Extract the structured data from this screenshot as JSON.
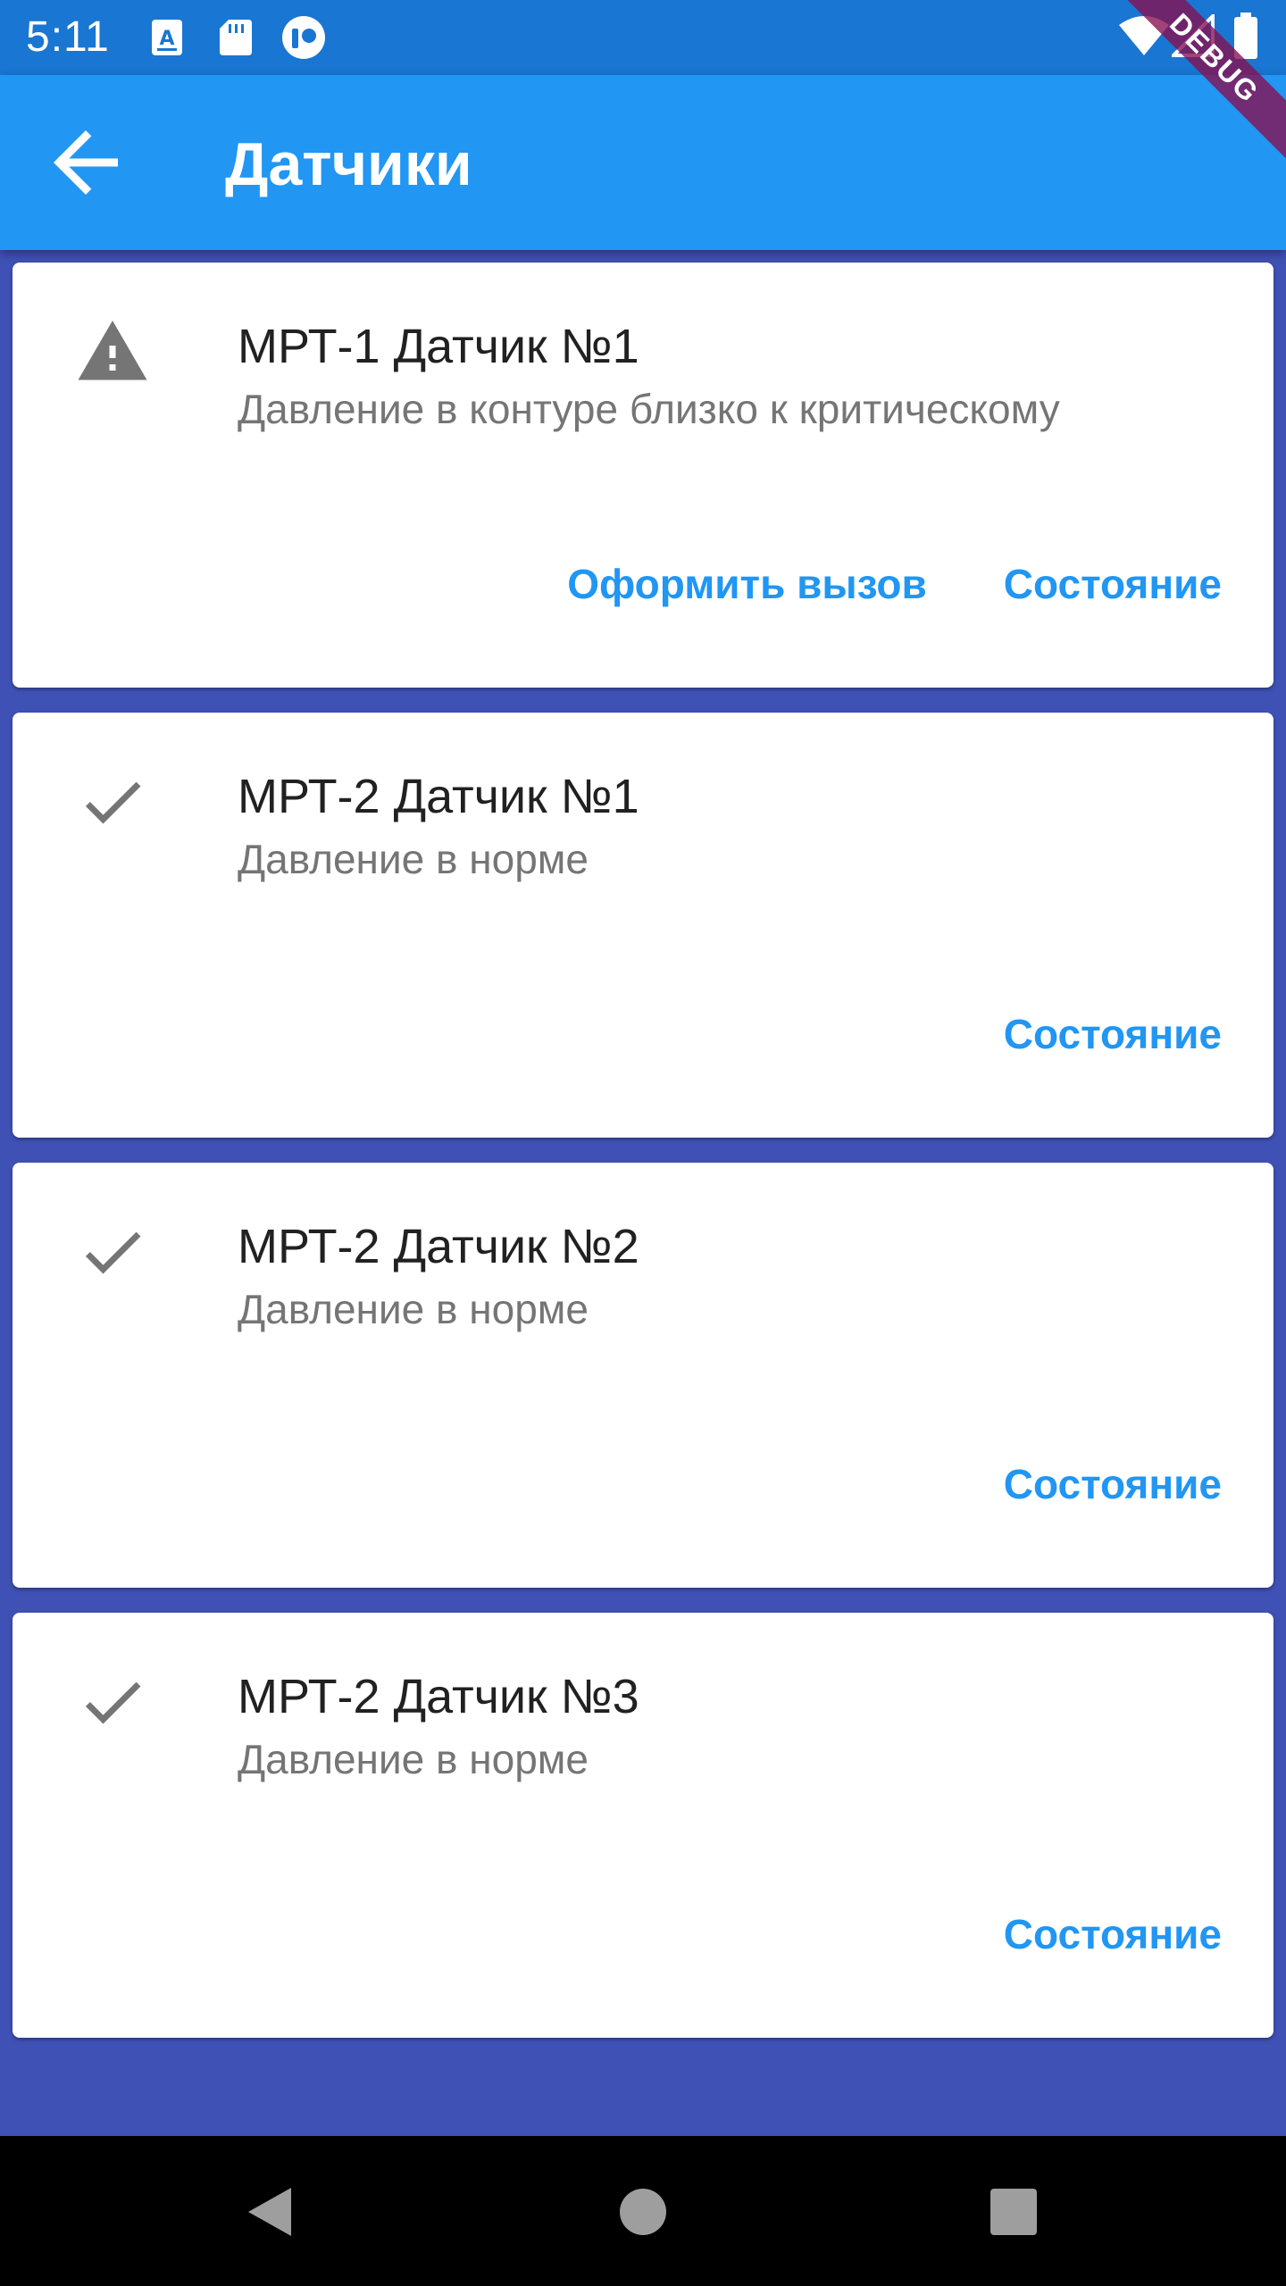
{
  "status_bar": {
    "time": "5:11",
    "icons": [
      "notification-a-icon",
      "sd-card-icon",
      "app-notification-icon",
      "wifi-icon",
      "signal-icon",
      "battery-icon"
    ]
  },
  "app_bar": {
    "title": "Датчики",
    "back_icon": "arrow-back-icon",
    "background": "#2196F3"
  },
  "debug_banner": "DEBUG",
  "sensors": [
    {
      "icon": "warning-icon",
      "title": "МРТ-1 Датчик №1",
      "subtitle": "Давление в контуре близко к критическому",
      "actions": [
        "Оформить вызов",
        "Состояние"
      ]
    },
    {
      "icon": "check-icon",
      "title": "МРТ-2 Датчик №1",
      "subtitle": "Давление в норме",
      "actions": [
        "Состояние"
      ]
    },
    {
      "icon": "check-icon",
      "title": "МРТ-2 Датчик №2",
      "subtitle": "Давление в норме",
      "actions": [
        "Состояние"
      ]
    },
    {
      "icon": "check-icon",
      "title": "МРТ-2 Датчик №3",
      "subtitle": "Давление в норме",
      "actions": [
        "Состояние"
      ]
    }
  ],
  "nav_bar": {
    "buttons": [
      "back-triangle-icon",
      "home-circle-icon",
      "recents-square-icon"
    ]
  },
  "colors": {
    "accent": "#2196F3",
    "background": "#3F51B5",
    "status_bar": "#1976D2"
  }
}
